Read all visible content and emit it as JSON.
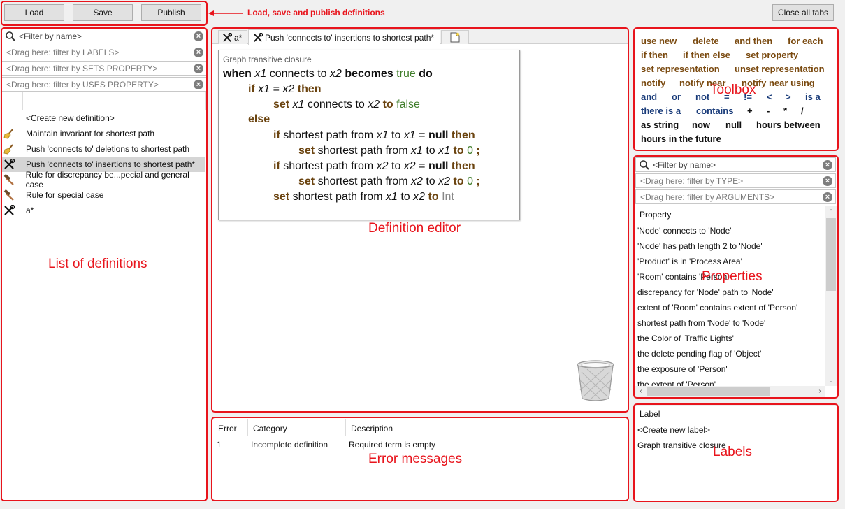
{
  "toolbar": {
    "load_label": "Load",
    "save_label": "Save",
    "publish_label": "Publish",
    "close_all_label": "Close all tabs",
    "annotation": "Load, save and publish definitions"
  },
  "left_panel": {
    "filters": [
      "<Filter by name>",
      "<Drag here: filter by LABELS>",
      "<Drag here: filter by SETS PROPERTY>",
      "<Drag here: filter by USES PROPERTY>"
    ],
    "items": [
      {
        "icon": "none",
        "label": "<Create new definition>"
      },
      {
        "icon": "broom-icon",
        "label": "Maintain invariant for shortest path"
      },
      {
        "icon": "broom-icon",
        "label": "Push 'connects to' deletions to shortest path"
      },
      {
        "icon": "tools-icon",
        "label": "Push 'connects to' insertions to shortest path*",
        "selected": true
      },
      {
        "icon": "hammer-icon",
        "label": "Rule for discrepancy be...pecial and general case"
      },
      {
        "icon": "hammer-icon",
        "label": "Rule for special case"
      },
      {
        "icon": "tools-icon",
        "label": "a*"
      }
    ],
    "annotation": "List of definitions"
  },
  "editor": {
    "tabs": [
      {
        "label": "a*"
      },
      {
        "label": "Push 'connects to' insertions to shortest path*"
      }
    ],
    "card_label": "Graph transitive closure",
    "annotation": "Definition editor",
    "code": {
      "l1": {
        "when": "when",
        "v1": "x1",
        "t1": "connects to",
        "v2": "x2",
        "becomes": "becomes",
        "val": "true",
        "do": "do"
      },
      "l2": {
        "if": "if",
        "v1": "x1",
        "eq": "=",
        "v2": "x2",
        "then": "then"
      },
      "l3": {
        "set": "set",
        "v1": "x1",
        "t1": "connects to",
        "v2": "x2",
        "to": "to",
        "val": "false"
      },
      "l4": {
        "else": "else"
      },
      "l5": {
        "if": "if",
        "t1": "shortest path from",
        "v1": "x1",
        "t2": "to",
        "v2": "x1",
        "eq": "=",
        "null": "null",
        "then": "then"
      },
      "l6": {
        "set": "set",
        "t1": "shortest path from",
        "v1": "x1",
        "t2": "to",
        "v2": "x1",
        "to": "to",
        "val": "0",
        "semi": ";"
      },
      "l7": {
        "if": "if",
        "t1": "shortest path from",
        "v1": "x2",
        "t2": "to",
        "v2": "x2",
        "eq": "=",
        "null": "null",
        "then": "then"
      },
      "l8": {
        "set": "set",
        "t1": "shortest path from",
        "v1": "x2",
        "t2": "to",
        "v2": "x2",
        "to": "to",
        "val": "0",
        "semi": ";"
      },
      "l9": {
        "set": "set",
        "t1": "shortest path from",
        "v1": "x1",
        "t2": "to",
        "v2": "x2",
        "to": "to",
        "val": "Int"
      }
    }
  },
  "errors": {
    "columns": [
      "Error",
      "Category",
      "Description"
    ],
    "rows": [
      {
        "num": "1",
        "category": "Incomplete definition",
        "description": "Required term is empty"
      }
    ],
    "annotation": "Error messages"
  },
  "toolbox": {
    "annotation": "Toolbox",
    "items": [
      "use new",
      "delete",
      "and then",
      "for each",
      "if then",
      "if then else",
      "set property",
      "set representation",
      "unset representation",
      "notify",
      "notify near",
      "notify near using",
      "and",
      "or",
      "not",
      "=",
      "!=",
      "<",
      ">",
      "is a",
      "there is a",
      "contains",
      "+",
      "-",
      "*",
      "/",
      "as string",
      "now",
      "null",
      "hours between",
      "hours in the future"
    ]
  },
  "properties": {
    "annotation": "Properties",
    "filters": [
      "<Filter by name>",
      "<Drag here: filter by TYPE>",
      "<Drag here: filter by ARGUMENTS>"
    ],
    "header": "Property",
    "items": [
      "'Node' connects to 'Node'",
      "'Node' has path length 2 to 'Node'",
      "'Product' is in 'Process Area'",
      "'Room' contains 'Person'",
      "discrepancy for 'Node' path to 'Node'",
      "extent of 'Room' contains extent of 'Person'",
      "shortest path from 'Node' to 'Node'",
      "the Color of 'Traffic Lights'",
      "the delete pending flag of 'Object'",
      "the exposure of 'Person'",
      "the extent of 'Person'"
    ]
  },
  "labels": {
    "annotation": "Labels",
    "header": "Label",
    "items": [
      "<Create new label>",
      "Graph transitive closure"
    ]
  }
}
